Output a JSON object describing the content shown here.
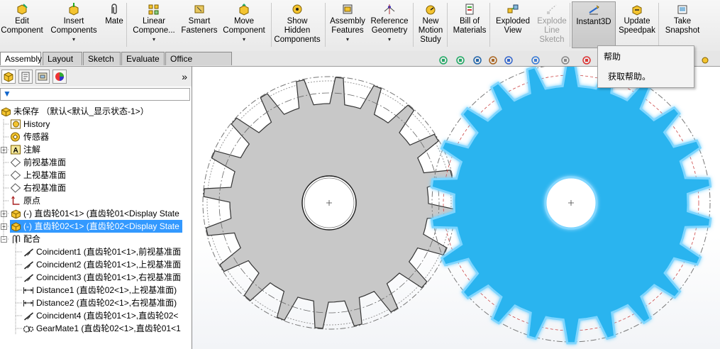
{
  "ribbon": {
    "buttons": [
      {
        "id": "edit-component",
        "label": "Edit\nComponent",
        "icon": "edit-component-icon",
        "dropdown": false
      },
      {
        "id": "insert-components",
        "label": "Insert\nComponents",
        "icon": "insert-components-icon",
        "dropdown": true
      },
      {
        "id": "mate",
        "label": "Mate",
        "icon": "paperclip-icon",
        "dropdown": false
      },
      {
        "id": "linear-component",
        "label": "Linear\nCompone...",
        "icon": "linear-pattern-icon",
        "dropdown": true
      },
      {
        "id": "smart-fasteners",
        "label": "Smart\nFasteners",
        "icon": "smart-fasteners-icon",
        "dropdown": false
      },
      {
        "id": "move-component",
        "label": "Move\nComponent",
        "icon": "move-component-icon",
        "dropdown": true
      },
      {
        "id": "show-hidden",
        "label": "Show\nHidden\nComponents",
        "icon": "show-hidden-icon",
        "dropdown": false
      },
      {
        "id": "assembly-features",
        "label": "Assembly\nFeatures",
        "icon": "assembly-features-icon",
        "dropdown": true
      },
      {
        "id": "reference-geometry",
        "label": "Reference\nGeometry",
        "icon": "reference-geometry-icon",
        "dropdown": true
      },
      {
        "id": "new-motion-study",
        "label": "New\nMotion\nStudy",
        "icon": "motion-study-icon",
        "dropdown": false
      },
      {
        "id": "bill-of-materials",
        "label": "Bill of\nMaterials",
        "icon": "bom-icon",
        "dropdown": false
      },
      {
        "id": "exploded-view",
        "label": "Exploded\nView",
        "icon": "exploded-view-icon",
        "dropdown": false
      },
      {
        "id": "explode-line-sketch",
        "label": "Explode\nLine\nSketch",
        "icon": "explode-line-sketch-icon",
        "dropdown": false,
        "disabled": true
      },
      {
        "id": "instant3d",
        "label": "Instant3D",
        "icon": "instant3d-icon",
        "dropdown": false,
        "active": true
      },
      {
        "id": "update-speedpak",
        "label": "Update\nSpeedpak",
        "icon": "speedpak-icon",
        "dropdown": false
      },
      {
        "id": "take-snapshot",
        "label": "Take\nSnapshot",
        "icon": "snapshot-icon",
        "dropdown": false
      }
    ]
  },
  "tabs": [
    {
      "label": "Assembly",
      "active": true
    },
    {
      "label": "Layout",
      "active": false
    },
    {
      "label": "Sketch",
      "active": false
    },
    {
      "label": "Evaluate",
      "active": false
    },
    {
      "label": "Office Products",
      "active": false
    }
  ],
  "tree": {
    "root": "未保存 （默认<默认_显示状态-1>）",
    "items": [
      {
        "label": "History",
        "icon": "history-icon"
      },
      {
        "label": "传感器",
        "icon": "sensor-icon"
      },
      {
        "label": "注解",
        "icon": "annotation-icon"
      },
      {
        "label": "前视基准面",
        "icon": "plane-icon"
      },
      {
        "label": "上视基准面",
        "icon": "plane-icon"
      },
      {
        "label": "右视基准面",
        "icon": "plane-icon"
      },
      {
        "label": "原点",
        "icon": "origin-icon"
      },
      {
        "label": "(-) 直齿轮01<1> (直齿轮01<Display State",
        "icon": "part-icon"
      },
      {
        "label": "(-) 直齿轮02<1> (直齿轮02<Display State",
        "icon": "part-icon",
        "selected": true
      },
      {
        "label": "配合",
        "icon": "mates-folder-icon"
      }
    ],
    "mates": [
      {
        "label": "Coincident1 (直齿轮01<1>,前视基准面",
        "icon": "coincident-icon"
      },
      {
        "label": "Coincident2 (直齿轮01<1>,上视基准面",
        "icon": "coincident-icon"
      },
      {
        "label": "Coincident3 (直齿轮01<1>,右视基准面",
        "icon": "coincident-icon"
      },
      {
        "label": "Distance1 (直齿轮02<1>,上视基准面)",
        "icon": "distance-icon"
      },
      {
        "label": "Distance2 (直齿轮02<1>,右视基准面)",
        "icon": "distance-icon"
      },
      {
        "label": "Coincident4 (直齿轮01<1>,直齿轮02<",
        "icon": "coincident-icon"
      },
      {
        "label": "GearMate1 (直齿轮02<1>,直齿轮01<1",
        "icon": "gear-mate-icon"
      }
    ]
  },
  "tooltip": {
    "title": "帮助",
    "description": "获取帮助。"
  },
  "viewport": {
    "gear1_color": "#c8c8c8",
    "gear2_color": "#2ab4ef",
    "selection_color": "#3399ff"
  }
}
